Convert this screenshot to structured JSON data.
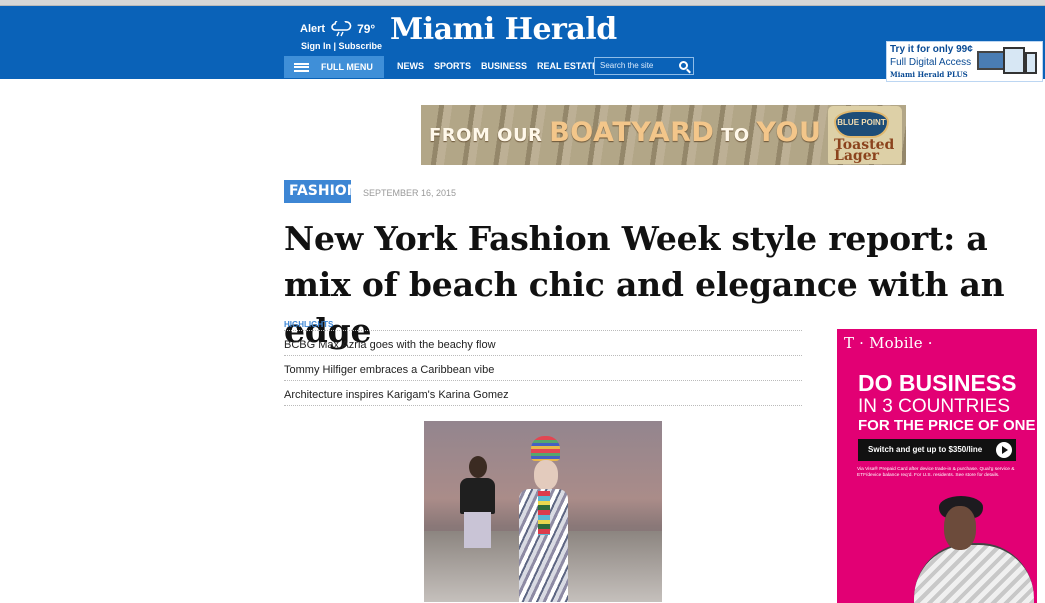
{
  "topbar": {
    "alert_label": "Alert",
    "temperature": "79°",
    "signin_label": "Sign In",
    "subscribe_label": "Subscribe",
    "logo_text": "Miami Herald",
    "full_menu_label": "FULL MENU",
    "nav_items": [
      "NEWS",
      "SPORTS",
      "BUSINESS",
      "REAL ESTATE"
    ],
    "search_placeholder": "Search the site"
  },
  "subscription_ad": {
    "title": "Try it for only 99¢",
    "subtitle": "Full Digital Access",
    "brand": "Miami Herald PLUS"
  },
  "banner_ad": {
    "lead_text": "FROM OUR",
    "big_text_1": "BOATYARD",
    "middle_text": "TO",
    "big_text_2": "YOU",
    "brand_text": "BLUE POINT",
    "product_text": "Toasted Lager"
  },
  "article": {
    "category": "FASHION",
    "date": "SEPTEMBER 16, 2015",
    "headline": "New York Fashion Week style report: a mix of beach chic and elegance with an edge",
    "highlights_title": "HIGHLIGHTS",
    "highlights": [
      "BCBG Max Azria goes with the beachy flow",
      "Tommy Hilfiger embraces a Caribbean vibe",
      "Architecture inspires Karigam's Karina Gomez"
    ]
  },
  "tmobile_ad": {
    "brand": "T · Mobile ·",
    "headline_1": "DO BUSINESS",
    "headline_2": "IN 3 COUNTRIES",
    "headline_3": "FOR THE PRICE OF ONE",
    "cta_label": "Switch and get up to $350/line",
    "fine_print": "Via Visa® Prepaid Card after device trade-in & purchase. Qual’g service & ETF/device balance req’d. For U.S. residents. See store for details."
  },
  "colors": {
    "masthead_blue": "#0a62b8",
    "category_blue": "#3d86d4",
    "tmobile_magenta": "#e20074"
  },
  "icons": {
    "weather": "cloud-rain-icon",
    "menu": "hamburger-icon",
    "search": "search-icon"
  }
}
